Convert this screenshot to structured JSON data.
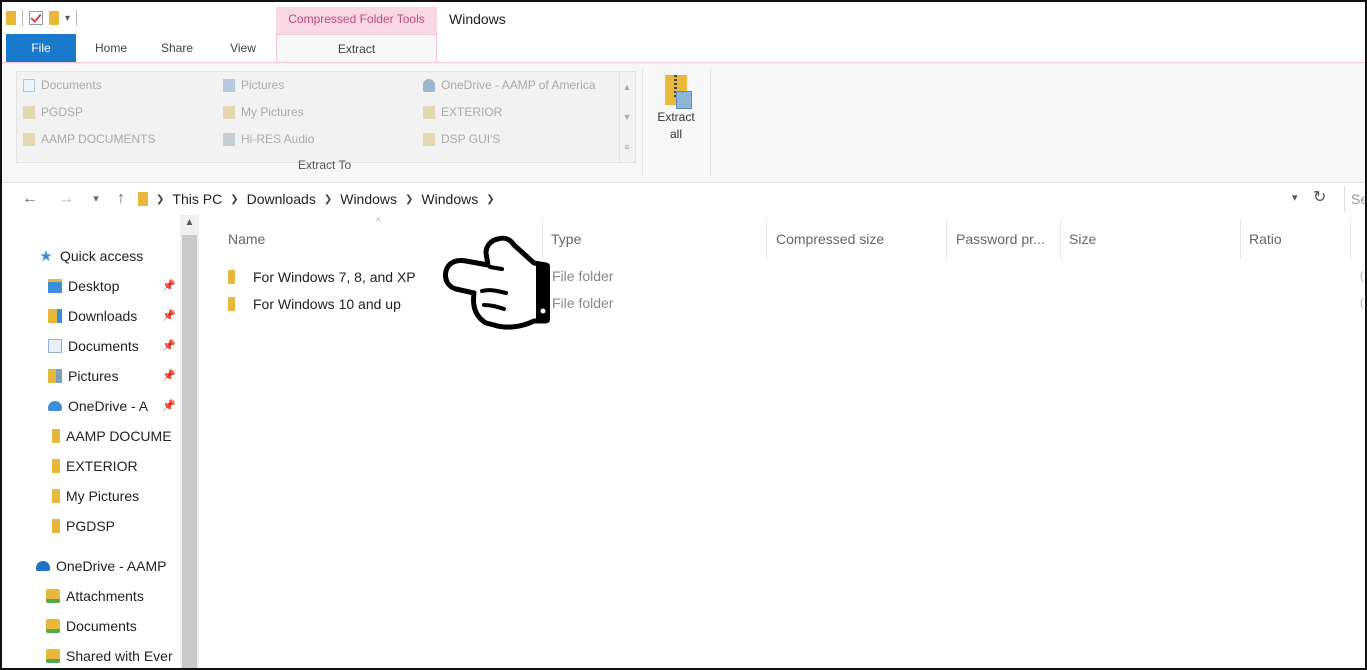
{
  "titlebar": {
    "context_tab_group": "Compressed Folder Tools",
    "window_title": "Windows"
  },
  "ribbon_tabs": {
    "file": "File",
    "home": "Home",
    "share": "Share",
    "view": "View",
    "extract": "Extract"
  },
  "extract_to": {
    "group_label": "Extract To",
    "items": [
      {
        "label": "Documents",
        "icon": "documents-icon"
      },
      {
        "label": "PGDSP",
        "icon": "folder-icon"
      },
      {
        "label": "AAMP DOCUMENTS",
        "icon": "folder-icon"
      },
      {
        "label": "Pictures",
        "icon": "pictures-icon"
      },
      {
        "label": "My Pictures",
        "icon": "folder-icon"
      },
      {
        "label": "Hi-RES Audio",
        "icon": "music-folder-icon"
      },
      {
        "label": "OneDrive - AAMP of America",
        "icon": "onedrive-icon"
      },
      {
        "label": "EXTERIOR",
        "icon": "folder-icon"
      },
      {
        "label": "DSP GUI'S",
        "icon": "folder-icon"
      }
    ]
  },
  "extract_all": {
    "line1": "Extract",
    "line2": "all"
  },
  "address": {
    "crumbs": [
      "This PC",
      "Downloads",
      "Windows",
      "Windows"
    ],
    "search_placeholder": "Se"
  },
  "nav_pane": {
    "quick_access": "Quick access",
    "items": [
      {
        "label": "Desktop",
        "pinned": true
      },
      {
        "label": "Downloads",
        "pinned": true
      },
      {
        "label": "Documents",
        "pinned": true
      },
      {
        "label": "Pictures",
        "pinned": true
      },
      {
        "label": "OneDrive - A",
        "pinned": true
      },
      {
        "label": "AAMP DOCUME",
        "pinned": false
      },
      {
        "label": "EXTERIOR",
        "pinned": false
      },
      {
        "label": "My Pictures",
        "pinned": false
      },
      {
        "label": "PGDSP",
        "pinned": false
      }
    ],
    "onedrive_root": "OneDrive - AAMP",
    "onedrive_items": [
      "Attachments",
      "Documents",
      "Shared with Ever"
    ]
  },
  "file_list": {
    "columns": [
      "Name",
      "Type",
      "Compressed size",
      "Password pr...",
      "Size",
      "Ratio"
    ],
    "rows": [
      {
        "name": "For Windows 7, 8, and XP",
        "type": "File folder"
      },
      {
        "name": "For Windows 10 and up",
        "type": "File folder"
      }
    ]
  },
  "overlay": {
    "icon": "pointing-hand-icon"
  }
}
